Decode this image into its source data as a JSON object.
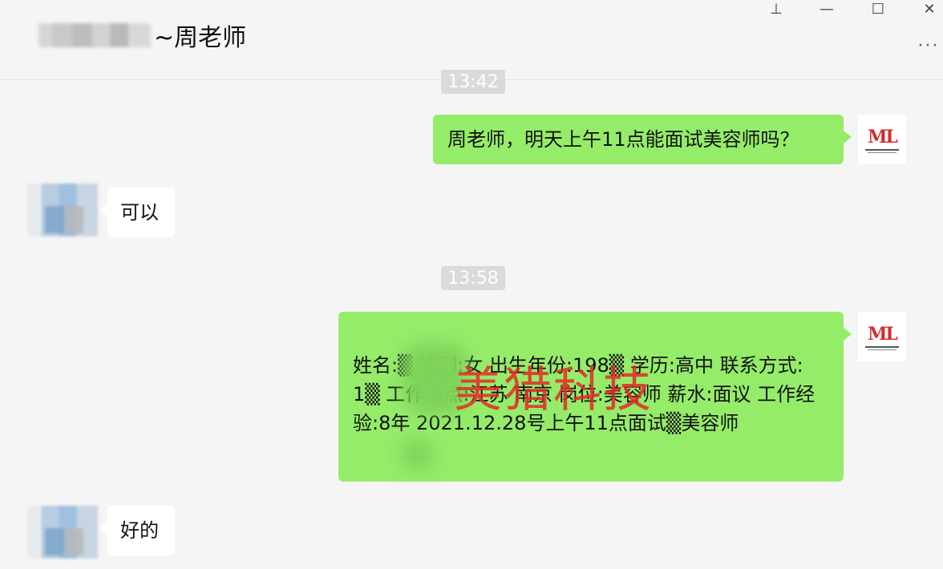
{
  "window": {
    "title_visible_suffix": "~周老师",
    "controls": {
      "pin": "pin-icon",
      "minimize": "minimize-icon",
      "maximize": "maximize-icon",
      "close": "close-icon",
      "more": "more-icon"
    }
  },
  "messages": [
    {
      "type": "timestamp",
      "text": "13:42"
    },
    {
      "type": "outgoing",
      "text": "周老师，明天上午11点能面试美容师吗？"
    },
    {
      "type": "incoming",
      "text": "可以"
    },
    {
      "type": "timestamp",
      "text": "13:58"
    },
    {
      "type": "outgoing",
      "text": "姓名:▒ 性别:女 出生年份:198▒ 学历:高中 联系方式: 1▒ 工作地点:江苏 南京 岗位:美容师 薪水:面议 工作经验:8年 2021.12.28号上午11点面试▒美容师"
    },
    {
      "type": "incoming",
      "text": "好的"
    }
  ],
  "watermark": "美猎科技",
  "avatar_me_logo": "ML"
}
